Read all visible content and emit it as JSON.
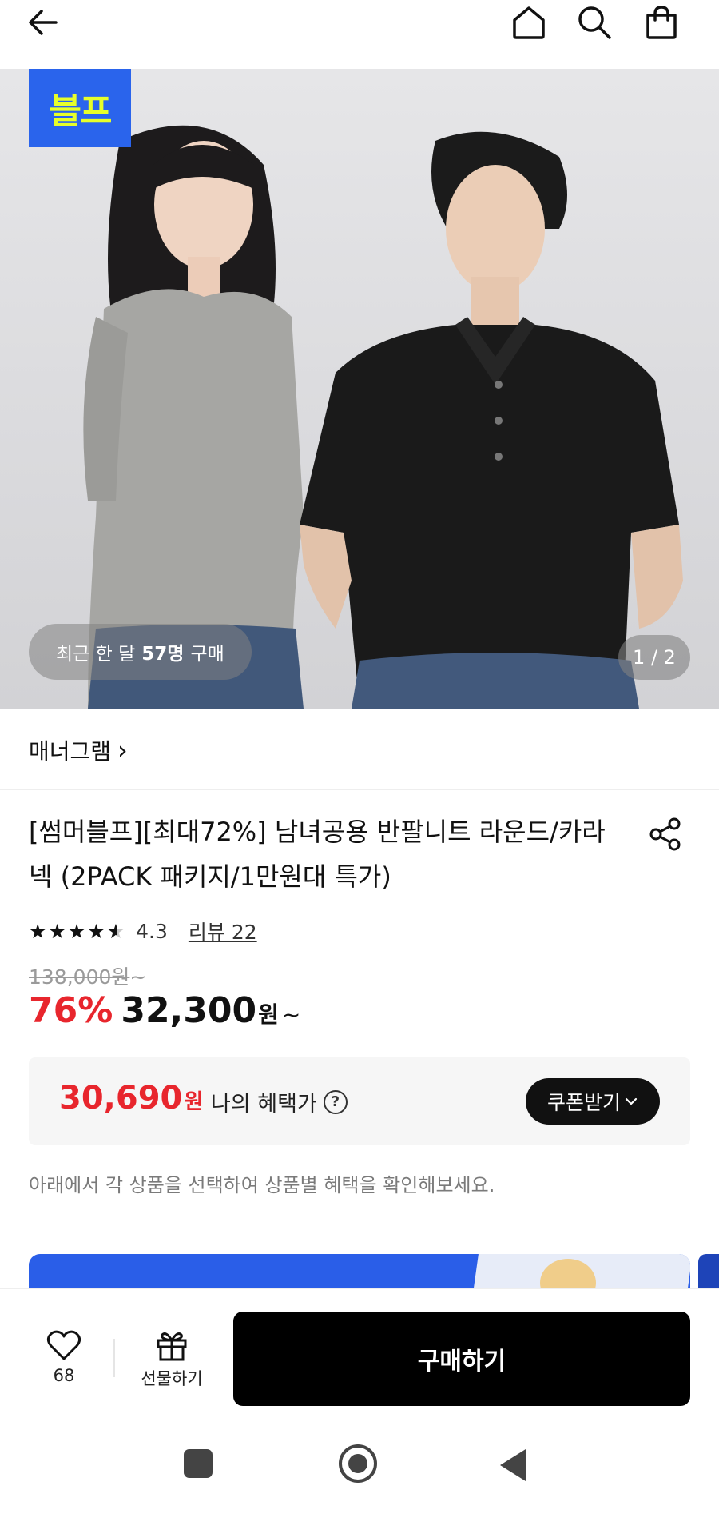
{
  "header": {
    "back_icon": "arrow-left-icon",
    "home_icon": "home-icon",
    "search_icon": "search-icon",
    "cart_icon": "shopping-bag-icon"
  },
  "hero": {
    "promo_badge_text": "블프",
    "recent_prefix": "최근 한 달",
    "recent_count": "57명",
    "recent_suffix": "구매",
    "page_indicator": "1 / 2"
  },
  "brand": {
    "name": "매너그램",
    "chevron": "›"
  },
  "product": {
    "title": "[썸머블프][최대72%] 남녀공용 반팔니트 라운드/카라넥 (2PACK 패키지/1만원대 특가)",
    "share_icon": "share-icon",
    "rating": "4.3",
    "rating_fraction": 0.86,
    "review_label": "리뷰 22",
    "original_price": "138,000원",
    "original_tilde": "~",
    "discount": "76%",
    "sale_price": "32,300",
    "sale_unit": "원",
    "sale_tilde": "~"
  },
  "benefit": {
    "price": "30,690",
    "unit": "원",
    "label": "나의 혜택가",
    "help_glyph": "?",
    "coupon_button": "쿠폰받기",
    "coupon_chevron": "⌄"
  },
  "notice": "아래에서 각 상품을 선택하여 상품별 혜택을 확인해보세요.",
  "bottom_bar": {
    "like_count": "68",
    "gift_label": "선물하기",
    "buy_label": "구매하기"
  },
  "colors": {
    "discount_red": "#e8262d",
    "buy_button": "#000000",
    "promo_blue": "#2a64ec",
    "promo_yellow": "#e6ff2a"
  }
}
